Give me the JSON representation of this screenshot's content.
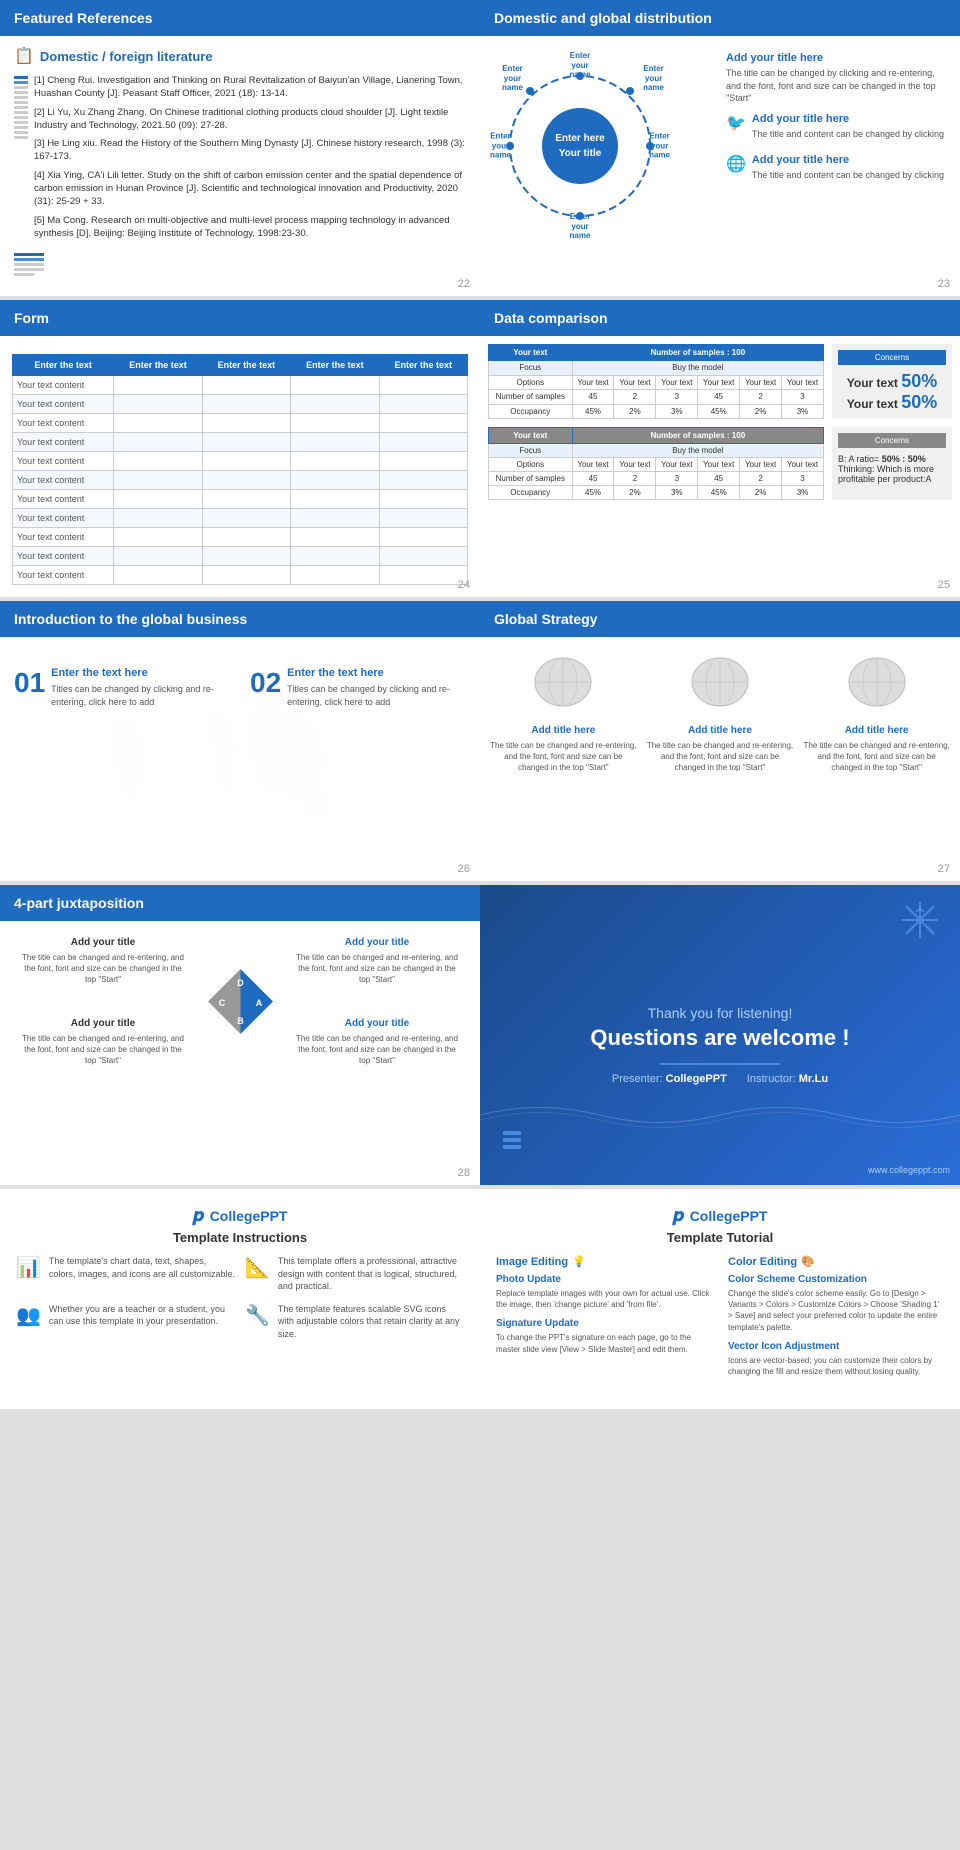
{
  "panels": {
    "featured_refs": {
      "title": "Featured References",
      "section_title": "Domestic / foreign literature",
      "refs": [
        "[1] Cheng Rui. Investigation and Thinking on Rural Revitalization of Baiyun'an Village, Lianering Town, Huashan County [J]. Peasant Staff Officer, 2021 (18): 13-14.",
        "[2] Li Yu, Xu Zhang Zhang. On Chinese traditional clothing products cloud shoulder [J]. Light textile Industry and Technology, 2021.50 (09): 27-28.",
        "[3] He Ling xiu. Read the History of the Southern Ming Dynasty [J]. Chinese history research, 1998 (3): 167-173.",
        "[4] Xia Ying, CA'i Lili letter. Study on the shift of carbon emission center and the spatial dependence of carbon emission in Hunan Province [J]. Scientific and technological innovation and Productivity, 2020 (31): 25-29 + 33.",
        "[5] Ma Cong. Research on multi-objective and multi-level process mapping technology in advanced synthesis [D]. Beijing: Beijing Institute of Technology, 1998:23-30."
      ],
      "page": "22"
    },
    "distribution": {
      "title": "Domestic and global distribution",
      "center_line1": "Enter here",
      "center_line2": "Your title",
      "orbits": [
        {
          "pos": "top",
          "text": "Enter\nyour\nname"
        },
        {
          "pos": "bottom",
          "text": "Enter\nyour\nname"
        },
        {
          "pos": "left",
          "text": "Enter\nyour\nname"
        },
        {
          "pos": "right",
          "text": "Enter\nyour\nname"
        },
        {
          "pos": "topleft",
          "text": "Enter\nyour\nname"
        },
        {
          "pos": "topright",
          "text": "Enter\nyour\nname"
        }
      ],
      "right_title1": "Add your title here",
      "right_desc1": "The title can be changed by clicking and re-entering, and the font, font and size can be changed in the top \"Start\"",
      "right_item1_title": "Add your title here",
      "right_item1_desc": "The title and content can be changed by clicking",
      "right_item2_title": "Add your title here",
      "right_item2_desc": "The title and content can be changed by clicking",
      "page": "23"
    },
    "form": {
      "title": "Form",
      "headers": [
        "Enter the text",
        "Enter the text",
        "Enter the text",
        "Enter the text",
        "Enter the text"
      ],
      "rows": [
        [
          "Your text content",
          "",
          "",
          "",
          ""
        ],
        [
          "Your text content",
          "",
          "",
          "",
          ""
        ],
        [
          "Your text content",
          "",
          "",
          "",
          ""
        ],
        [
          "Your text content",
          "",
          "",
          "",
          ""
        ],
        [
          "Your text content",
          "",
          "",
          "",
          ""
        ],
        [
          "Your text content",
          "",
          "",
          "",
          ""
        ],
        [
          "Your text content",
          "",
          "",
          "",
          ""
        ],
        [
          "Your text content",
          "",
          "",
          "",
          ""
        ],
        [
          "Your text content",
          "",
          "",
          "",
          ""
        ],
        [
          "Your text content",
          "",
          "",
          "",
          ""
        ],
        [
          "Your text content",
          "",
          "",
          "",
          ""
        ]
      ],
      "page": "24"
    },
    "data_comparison": {
      "title": "Data comparison",
      "table1_header1": "Your text",
      "table1_header2": "Number of samples : 100",
      "table1_concerns_title": "Concerns",
      "table1_concerns_text1": "Your text 50%",
      "table1_concerns_text2": "Your text 50%",
      "table2_concerns_title": "Concerns",
      "table2_concerns_text": "B: A ratio= 50% : 50%\nThinking: Which is more profitable per product:A",
      "page": "25"
    },
    "global_biz": {
      "title": "Introduction to the global business",
      "item1_num": "01",
      "item1_title": "Enter the text here",
      "item1_desc": "Titles can be changed by clicking and re-entering, click here to add",
      "item2_num": "02",
      "item2_title": "Enter the text here",
      "item2_desc": "Titles can be changed by clicking and re-entering, click here to add",
      "page": "26"
    },
    "global_strategy": {
      "title": "Global Strategy",
      "card1_title": "Add title here",
      "card1_desc": "The title can be changed and re-entering, and the font, font and size can be changed in the top \"Start\"",
      "card2_title": "Add title here",
      "card2_desc": "The title can be changed and re-entering, and the font, font and size can be changed in the top \"Start\"",
      "card3_title": "Add title here",
      "card3_desc": "The title can be changed and re-entering, and the font, font and size can be changed in the top \"Start\"",
      "page": "27"
    },
    "juxtaposition": {
      "title": "4-part juxtaposition",
      "item1_title": "Add your title",
      "item1_desc": "The title can be changed and re-entering, and the font, font and size can be changed in the top \"Start\"",
      "item2_title": "Add your title",
      "item2_desc": "The title can be changed and re-entering, and the font, font and size can be changed in the top \"Start\"",
      "item3_title": "Add your title",
      "item3_desc": "The title can be changed and re-entering, and the font, font and size can be changed in the top \"Start\"",
      "item4_title": "Add your title",
      "item4_desc": "The title can be changed and re-entering, and the font, font and size can be changed in the top \"Start\"",
      "page": "28"
    },
    "thankyou": {
      "small_text": "Thank you for listening!",
      "big_text": "Questions are welcome !",
      "presenter_label": "Presenter:",
      "presenter_name": "CollegePPT",
      "instructor_label": "Instructor:",
      "instructor_name": "Mr.Lu",
      "website": "www.collegeppt.com"
    },
    "tutorial_left": {
      "logo_text": "CollegePPT",
      "subtitle": "Template Instructions",
      "item1_text": "The template's chart data, text, shapes, colors, images, and icons are all customizable.",
      "item2_text": "This template offers a professional, attractive design with content that is logical, structured, and practical.",
      "item3_text": "Whether you are a teacher or a student, you can use this template in your presentation.",
      "item4_text": "The template features scalable SVG icons with adjustable colors that retain clarity at any size."
    },
    "tutorial_right": {
      "logo_text": "CollegePPT",
      "subtitle": "Template Tutorial",
      "image_editing_title": "Image Editing",
      "photo_update_title": "Photo Update",
      "photo_update_text": "Replace template images with your own for actual use. Click the image, then 'change picture' and 'from file'.",
      "signature_update_title": "Signature Update",
      "signature_update_text": "To change the PPT's signature on each page, go to the master slide view [View > Slide Master] and edit them.",
      "color_editing_title": "Color Editing",
      "color_scheme_title": "Color Scheme Customization",
      "color_scheme_text": "Change the slide's color scheme easily. Go to [Design > Variants > Colors > Customize Colors > Choose 'Shading 1' > Save] and select your preferred color to update the entire template's palette.",
      "vector_icon_title": "Vector Icon Adjustment",
      "vector_icon_text": "Icons are vector-based; you can customize their colors by changing the fill and resize them without losing quality."
    }
  }
}
